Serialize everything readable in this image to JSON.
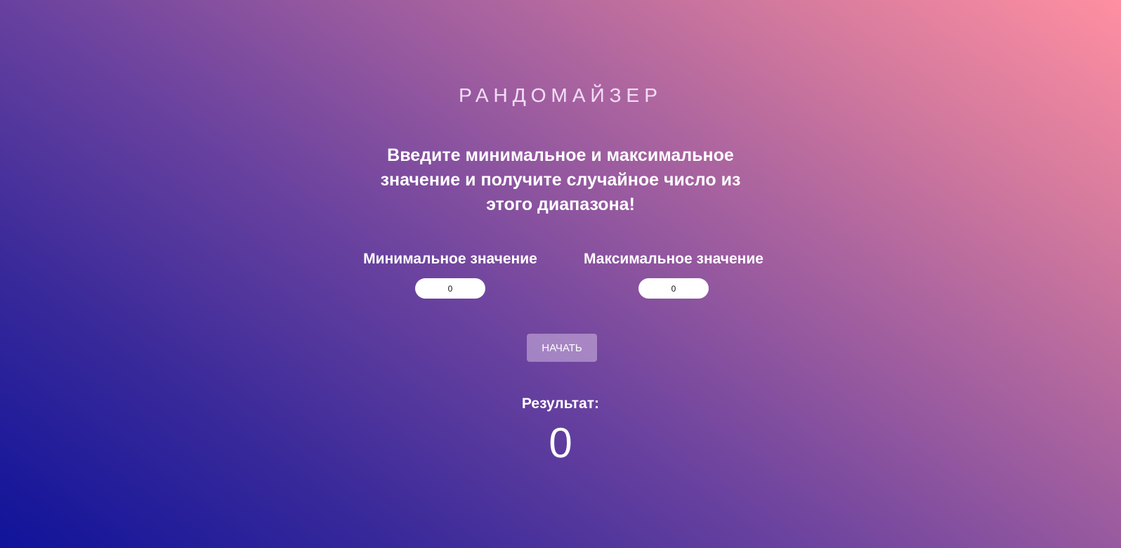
{
  "page": {
    "title": "РАНДОМАЙЗЕР",
    "description": "Введите минимальное и максимальное значение и получите случайное число из этого диапазона!"
  },
  "form": {
    "min": {
      "label": "Минимальное значение",
      "value": "0"
    },
    "max": {
      "label": "Максимальное значение",
      "value": "0"
    },
    "start_label": "НАЧАТЬ"
  },
  "result": {
    "label": "Результат:",
    "value": "0"
  },
  "colors": {
    "gradient_start": "#10139a",
    "gradient_end": "#ff8fa1",
    "button_bg": "#b189c8",
    "text": "#ffffff"
  }
}
